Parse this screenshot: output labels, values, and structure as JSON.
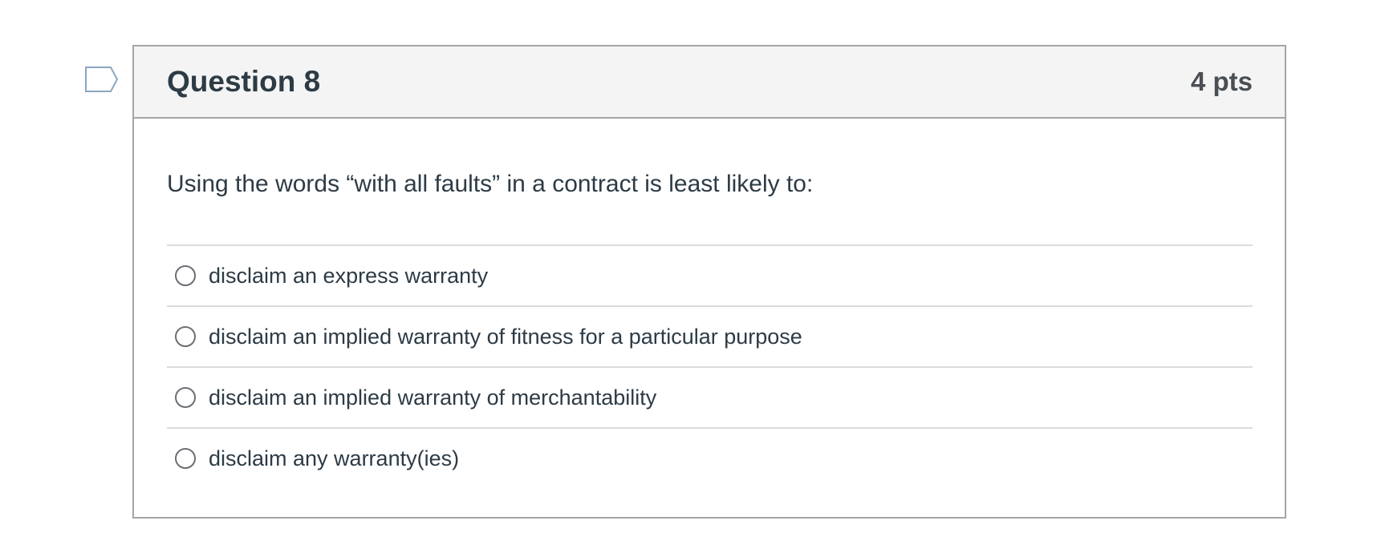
{
  "question": {
    "title": "Question 8",
    "points": "4 pts",
    "text": "Using the words “with all faults” in a contract is least likely to:",
    "flag_icon": "flag-outline-icon",
    "answers": [
      {
        "label": "disclaim an express warranty",
        "selected": false
      },
      {
        "label": "disclaim an implied warranty of ﬁtness for a particular purpose",
        "selected": false
      },
      {
        "label": "disclaim an implied warranty of merchantability",
        "selected": false
      },
      {
        "label": "disclaim any warranty(ies)",
        "selected": false
      }
    ]
  },
  "colors": {
    "header_bg": "#f4f4f4",
    "border": "#a5a5a5",
    "divider": "#dcdcdc",
    "text": "#2d3b45",
    "flag": "#8ba6c1"
  }
}
